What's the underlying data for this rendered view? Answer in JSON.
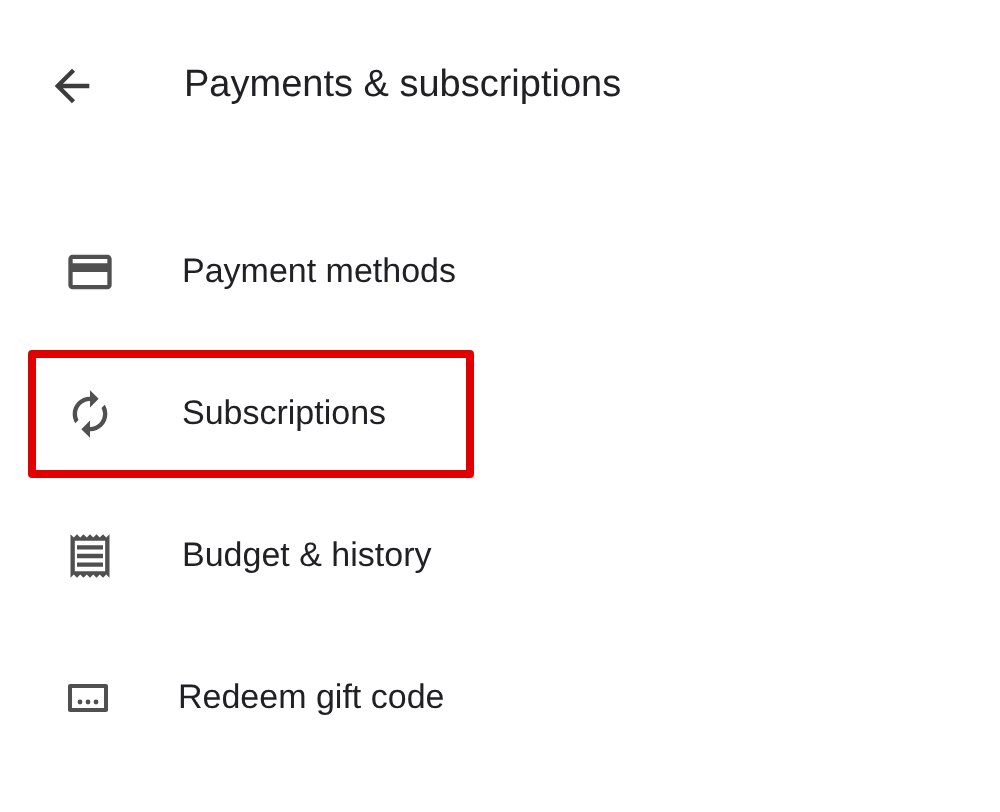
{
  "header": {
    "title": "Payments & subscriptions"
  },
  "menu": [
    {
      "label": "Payment methods",
      "highlighted": false
    },
    {
      "label": "Subscriptions",
      "highlighted": true
    },
    {
      "label": "Budget & history",
      "highlighted": false
    },
    {
      "label": "Redeem gift code",
      "highlighted": false
    }
  ]
}
